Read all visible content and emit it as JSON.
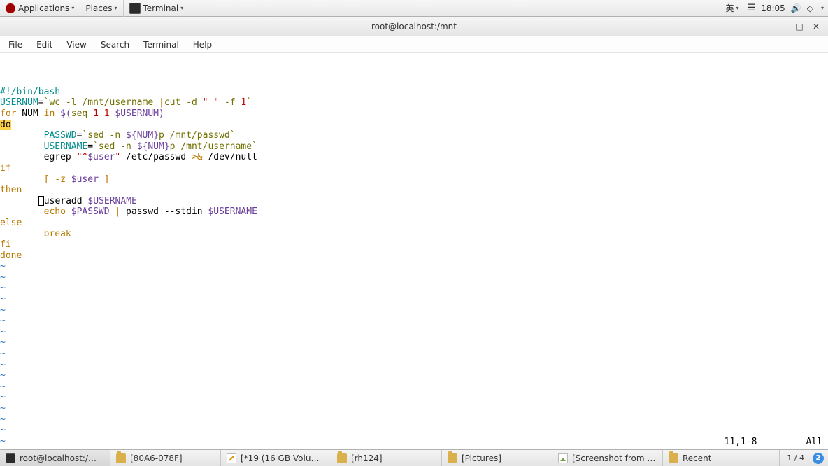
{
  "top_panel": {
    "applications": "Applications",
    "places": "Places",
    "terminal": "Terminal",
    "ime": "英",
    "time": "18:05"
  },
  "window": {
    "title": "root@localhost:/mnt",
    "controls": {
      "min": "—",
      "max": "□",
      "close": "✕"
    }
  },
  "menubar": {
    "file": "File",
    "edit": "Edit",
    "view": "View",
    "search": "Search",
    "terminal": "Terminal",
    "help": "Help"
  },
  "editor": {
    "lines": [
      {
        "segments": [
          {
            "t": "#!/bin/bash",
            "cls": "c-cyan"
          }
        ]
      },
      {
        "segments": [
          {
            "t": "USERNUM",
            "cls": "c-cyan"
          },
          {
            "t": "=",
            "cls": "c-text"
          },
          {
            "t": "`",
            "cls": "c-olive"
          },
          {
            "t": "wc -l /mnt/username ",
            "cls": "c-olive"
          },
          {
            "t": "|",
            "cls": "c-orange"
          },
          {
            "t": "cut -d ",
            "cls": "c-olive"
          },
          {
            "t": "\" \"",
            "cls": "c-red"
          },
          {
            "t": " -f ",
            "cls": "c-olive"
          },
          {
            "t": "1",
            "cls": "c-red"
          },
          {
            "t": "`",
            "cls": "c-olive"
          }
        ]
      },
      {
        "segments": [
          {
            "t": "for",
            "cls": "c-orange"
          },
          {
            "t": " NUM ",
            "cls": "c-text"
          },
          {
            "t": "in",
            "cls": "c-orange"
          },
          {
            "t": " ",
            "cls": "c-text"
          },
          {
            "t": "$(",
            "cls": "c-purple"
          },
          {
            "t": "seq ",
            "cls": "c-olive"
          },
          {
            "t": "1 1",
            "cls": "c-red"
          },
          {
            "t": " ",
            "cls": "c-olive"
          },
          {
            "t": "$USERNUM",
            "cls": "c-purple"
          },
          {
            "t": ")",
            "cls": "c-purple"
          }
        ]
      },
      {
        "segments": [
          {
            "t": "do",
            "cls": "bg-yellow"
          }
        ]
      },
      {
        "segments": [
          {
            "t": "        ",
            "cls": "c-text"
          },
          {
            "t": "PASSWD",
            "cls": "c-cyan"
          },
          {
            "t": "=",
            "cls": "c-text"
          },
          {
            "t": "`",
            "cls": "c-olive"
          },
          {
            "t": "sed -n ",
            "cls": "c-olive"
          },
          {
            "t": "${",
            "cls": "c-purple"
          },
          {
            "t": "NUM",
            "cls": "c-purple"
          },
          {
            "t": "}",
            "cls": "c-purple"
          },
          {
            "t": "p /mnt/passwd",
            "cls": "c-olive"
          },
          {
            "t": "`",
            "cls": "c-olive"
          }
        ]
      },
      {
        "segments": [
          {
            "t": "        ",
            "cls": "c-text"
          },
          {
            "t": "USERNAME",
            "cls": "c-cyan"
          },
          {
            "t": "=",
            "cls": "c-text"
          },
          {
            "t": "`",
            "cls": "c-olive"
          },
          {
            "t": "sed -n ",
            "cls": "c-olive"
          },
          {
            "t": "${",
            "cls": "c-purple"
          },
          {
            "t": "NUM",
            "cls": "c-purple"
          },
          {
            "t": "}",
            "cls": "c-purple"
          },
          {
            "t": "p /mnt/username",
            "cls": "c-olive"
          },
          {
            "t": "`",
            "cls": "c-olive"
          }
        ]
      },
      {
        "segments": [
          {
            "t": "        egrep ",
            "cls": "c-text"
          },
          {
            "t": "\"^",
            "cls": "c-red"
          },
          {
            "t": "$user",
            "cls": "c-purple"
          },
          {
            "t": "\"",
            "cls": "c-red"
          },
          {
            "t": " /etc/passwd ",
            "cls": "c-text"
          },
          {
            "t": ">&",
            "cls": "c-orange"
          },
          {
            "t": " /dev/null",
            "cls": "c-text"
          }
        ]
      },
      {
        "segments": [
          {
            "t": "if",
            "cls": "c-orange"
          }
        ]
      },
      {
        "segments": [
          {
            "t": "        ",
            "cls": "c-text"
          },
          {
            "t": "[",
            "cls": "c-orange"
          },
          {
            "t": " ",
            "cls": "c-text"
          },
          {
            "t": "-z",
            "cls": "c-orange"
          },
          {
            "t": " ",
            "cls": "c-text"
          },
          {
            "t": "$user",
            "cls": "c-purple"
          },
          {
            "t": " ",
            "cls": "c-text"
          },
          {
            "t": "]",
            "cls": "c-orange"
          }
        ]
      },
      {
        "segments": [
          {
            "t": "then",
            "cls": "c-orange"
          }
        ]
      },
      {
        "cursor_at": 7,
        "segments": [
          {
            "t": "       ",
            "cls": "c-text"
          },
          {
            "t": "",
            "cursor": true
          },
          {
            "t": "useradd ",
            "cls": "c-text"
          },
          {
            "t": "$USERNAME",
            "cls": "c-purple"
          }
        ]
      },
      {
        "segments": [
          {
            "t": "        ",
            "cls": "c-text"
          },
          {
            "t": "echo",
            "cls": "c-orange"
          },
          {
            "t": " ",
            "cls": "c-text"
          },
          {
            "t": "$PASSWD",
            "cls": "c-purple"
          },
          {
            "t": " ",
            "cls": "c-text"
          },
          {
            "t": "|",
            "cls": "c-orange"
          },
          {
            "t": " passwd --stdin ",
            "cls": "c-text"
          },
          {
            "t": "$USERNAME",
            "cls": "c-purple"
          }
        ]
      },
      {
        "segments": [
          {
            "t": "else",
            "cls": "c-orange"
          }
        ]
      },
      {
        "segments": [
          {
            "t": "        ",
            "cls": "c-text"
          },
          {
            "t": "break",
            "cls": "c-orange"
          }
        ]
      },
      {
        "segments": [
          {
            "t": "fi",
            "cls": "c-orange"
          }
        ]
      },
      {
        "segments": [
          {
            "t": "done",
            "cls": "c-orange"
          }
        ]
      }
    ],
    "tilde": "~",
    "tilde_count": 18,
    "status_pos": "11,1-8",
    "status_pct": "All"
  },
  "taskbar": {
    "buttons": [
      {
        "label": "root@localhost:/mnt",
        "icon": "term",
        "active": true
      },
      {
        "label": "[80A6-078F]",
        "icon": "folder"
      },
      {
        "label": "[*19 (16 GB Volum...",
        "icon": "edit"
      },
      {
        "label": "[rh124]",
        "icon": "folder"
      },
      {
        "label": "[Pictures]",
        "icon": "folder"
      },
      {
        "label": "[Screenshot from 20...",
        "icon": "image"
      },
      {
        "label": "Recent",
        "icon": "folder"
      }
    ],
    "workspace": "1 / 4",
    "ws_badge": "2"
  }
}
